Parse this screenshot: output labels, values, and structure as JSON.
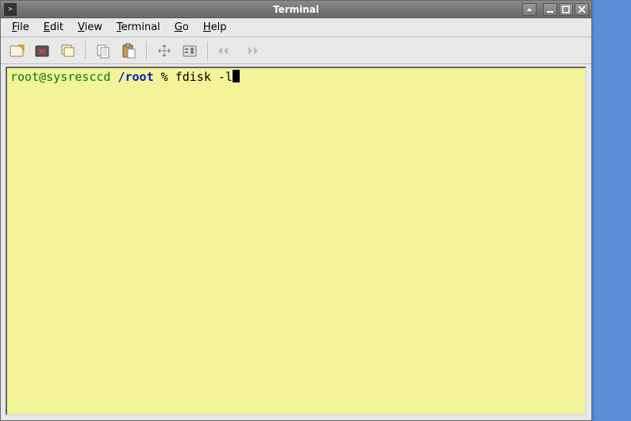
{
  "window": {
    "title": "Terminal"
  },
  "menubar": {
    "file": "File",
    "edit": "Edit",
    "view": "View",
    "terminal": "Terminal",
    "go": "Go",
    "help": "Help"
  },
  "toolbar_icons": {
    "newtab": "new-tab-icon",
    "closetab": "close-tab-icon",
    "newwindow": "new-window-icon",
    "copy": "copy-icon",
    "paste": "paste-icon",
    "fullscreen": "fullscreen-icon",
    "preferences": "preferences-icon",
    "prev": "prev-tab-icon",
    "next": "next-tab-icon"
  },
  "terminal": {
    "prompt_user": "root@sysresccd",
    "prompt_path": "/root",
    "prompt_symbol": "%",
    "command": "fdisk -l"
  }
}
